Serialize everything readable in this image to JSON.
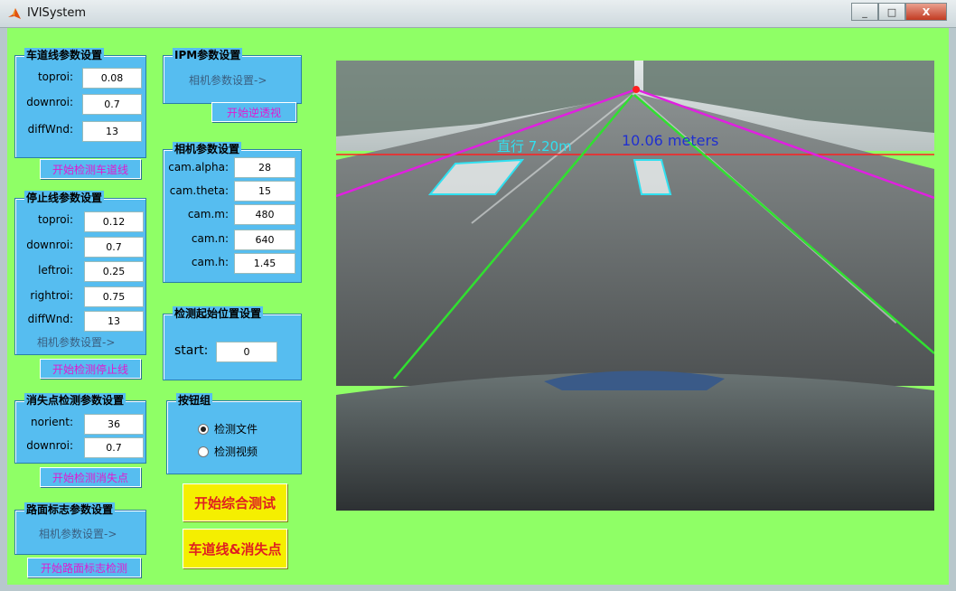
{
  "window": {
    "title": "IVISystem",
    "buttons": [
      "_",
      "□",
      "X"
    ]
  },
  "lane_params": {
    "title": "车道线参数设置",
    "fields": [
      {
        "label": "toproi:",
        "value": "0.08"
      },
      {
        "label": "downroi:",
        "value": "0.7"
      },
      {
        "label": "diffWnd:",
        "value": "13"
      }
    ],
    "button": "开始检测车道线"
  },
  "stopline_params": {
    "title": "停止线参数设置",
    "fields": [
      {
        "label": "toproi:",
        "value": "0.12"
      },
      {
        "label": "downroi:",
        "value": "0.7"
      },
      {
        "label": "leftroi:",
        "value": "0.25"
      },
      {
        "label": "rightroi:",
        "value": "0.75"
      },
      {
        "label": "diffWnd:",
        "value": "13"
      }
    ],
    "link": "相机参数设置->",
    "button": "开始检测停止线"
  },
  "vanish_params": {
    "title": "消失点检测参数设置",
    "fields": [
      {
        "label": "norient:",
        "value": "36"
      },
      {
        "label": "downroi:",
        "value": "0.7"
      }
    ],
    "button": "开始检测消失点"
  },
  "roadmark_params": {
    "title": "路面标志参数设置",
    "link": "相机参数设置->",
    "button": "开始路面标志检测"
  },
  "ipm_params": {
    "title": "IPM参数设置",
    "link": "相机参数设置->",
    "button": "开始逆透视"
  },
  "camera_params": {
    "title": "相机参数设置",
    "fields": [
      {
        "label": "cam.alpha:",
        "value": "28"
      },
      {
        "label": "cam.theta:",
        "value": "15"
      },
      {
        "label": "cam.m:",
        "value": "480"
      },
      {
        "label": "cam.n:",
        "value": "640"
      },
      {
        "label": "cam.h:",
        "value": "1.45"
      }
    ]
  },
  "start_params": {
    "title": "检测起始位置设置",
    "label": "start:",
    "value": "0"
  },
  "button_group": {
    "title": "按钮组",
    "options": [
      {
        "label": "检测文件",
        "selected": true
      },
      {
        "label": "检测视频",
        "selected": false
      }
    ]
  },
  "actions": {
    "combined_test": "开始综合测试",
    "lane_vanish": "车道线&消失点"
  },
  "video": {
    "distance_label": "10.06 meters",
    "overlay_label": "直行 7.20m",
    "colors": {
      "horizon": "#ff2020",
      "vanish_lines": "#e020e0",
      "lane_lines": "#30e030",
      "marks": "#30e0f0",
      "label": "#2030d0"
    }
  }
}
